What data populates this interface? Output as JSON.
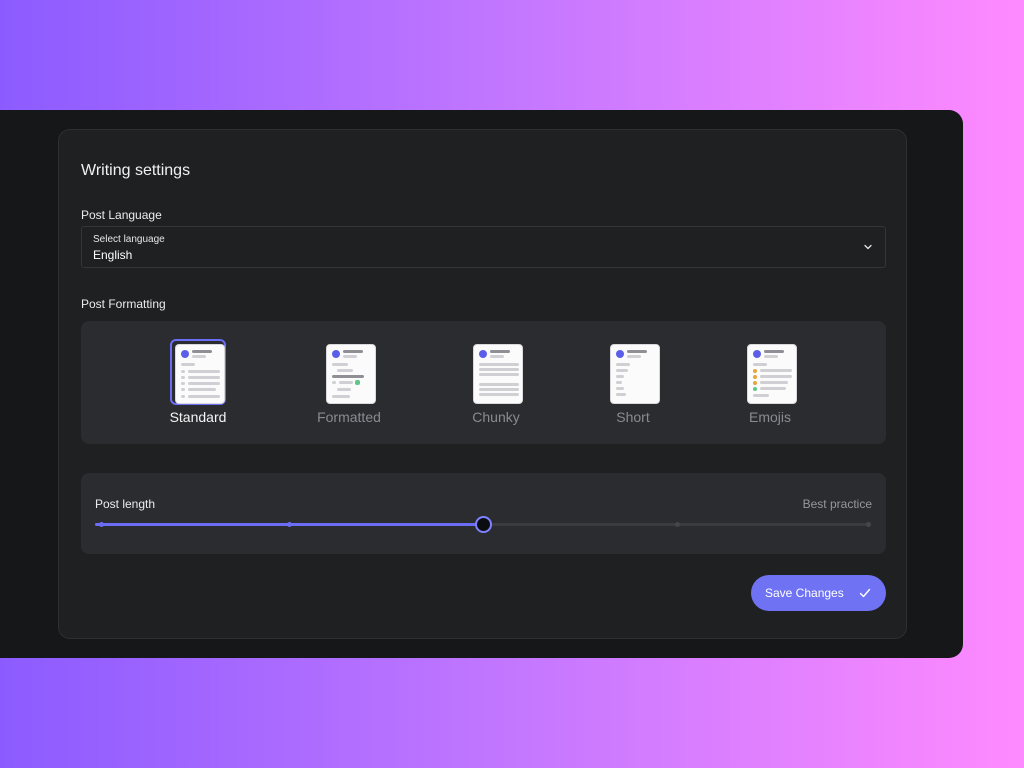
{
  "panel": {
    "title": "Writing settings"
  },
  "language": {
    "label": "Post Language",
    "select_caption": "Select language",
    "selected_value": "English",
    "icon": "chevron-down-icon"
  },
  "formatting": {
    "label": "Post Formatting",
    "selected": "Standard",
    "options": [
      {
        "label": "Standard",
        "selected": true
      },
      {
        "label": "Formatted",
        "selected": false
      },
      {
        "label": "Chunky",
        "selected": false
      },
      {
        "label": "Short",
        "selected": false
      },
      {
        "label": "Emojis",
        "selected": false
      }
    ]
  },
  "length": {
    "label": "Post length",
    "hint": "Best practice",
    "steps": 5,
    "selected_step_index": 2,
    "value_fraction": 0.5
  },
  "actions": {
    "save_label": "Save Changes",
    "save_icon": "check-icon"
  },
  "colors": {
    "accent": "#6b6ef5",
    "background_dark": "#161719",
    "card": "#1f2022",
    "panel": "#2b2c2f"
  }
}
